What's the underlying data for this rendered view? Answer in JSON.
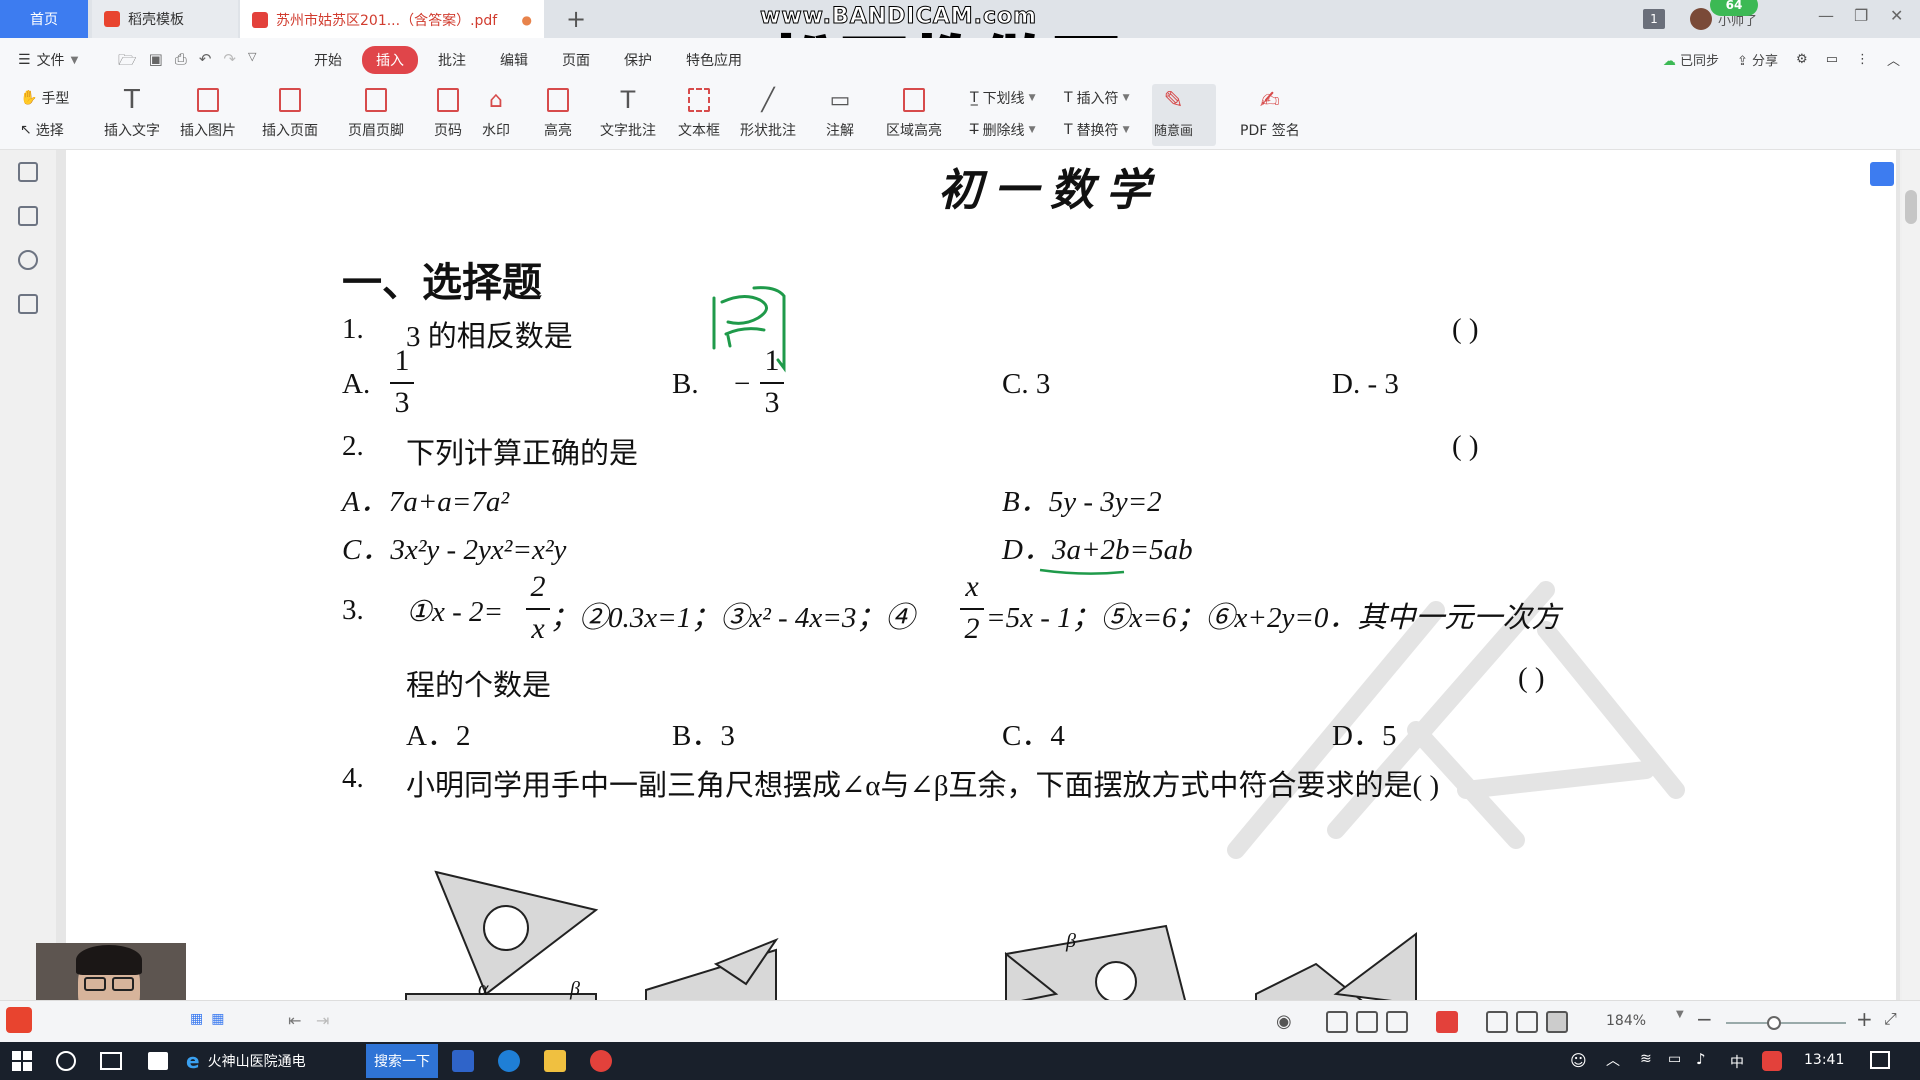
{
  "tabbar": {
    "home": "首页",
    "tab1": "稻壳模板",
    "tab2": "苏州市姑苏区201...（含答案）.pdf",
    "tab2_dot": "●",
    "add": "+",
    "page_badge": "1",
    "user_name": "小帅了",
    "badge": "64"
  },
  "menu": {
    "file": "文件",
    "tabs": [
      "开始",
      "插入",
      "批注",
      "编辑",
      "页面",
      "保护",
      "特色应用"
    ],
    "active": "插入",
    "synced": "已同步",
    "share": "分享"
  },
  "ribbon": {
    "hand": "手型",
    "select": "选择",
    "items": [
      "插入文字",
      "插入图片",
      "插入页面",
      "页眉页脚",
      "页码",
      "水印",
      "高亮",
      "文字批注",
      "文本框",
      "形状批注",
      "注解",
      "区域高亮",
      "随意画",
      "PDF 签名"
    ],
    "underline": "下划线",
    "strike": "删除线",
    "insert_mark": "插入符",
    "replace_mark": "替换符"
  },
  "overlay": {
    "bandicam": "www.BANDICAM.com",
    "title": "松哥教做题"
  },
  "doc": {
    "title": "初一数学",
    "section": "一、选择题",
    "q1": {
      "num": "1.",
      "text": "3 的相反数是",
      "paren": "(        )",
      "A": "A.",
      "B": "B.",
      "B_sign": "−",
      "C": "C.  3",
      "D": "D.  - 3",
      "frac_num": "1",
      "frac_den": "3"
    },
    "q2": {
      "num": "2.",
      "text": "下列计算正确的是",
      "paren": "(        )",
      "A": "A．7a+a=7a²",
      "B": "B．5y - 3y=2",
      "C": "C．3x²y - 2yx²=x²y",
      "D": "D．3a+2b=5ab"
    },
    "q3": {
      "num": "3.",
      "text1": "①x - 2=",
      "frac1_num": "2",
      "frac1_den": "x",
      "text2": "；②0.3x=1；③x² - 4x=3；④",
      "frac2_num": "x",
      "frac2_den": "2",
      "text3": "=5x - 1；⑤x=6；⑥x+2y=0．其中一元一次方",
      "text4": "程的个数是",
      "paren": "(        )",
      "A": "A．2",
      "B": "B．3",
      "C": "C．4",
      "D": "D．5"
    },
    "q4": {
      "num": "4.",
      "text": "小明同学用手中一副三角尺想摆成∠α与∠β互余，下面摆放方式中符合要求的是(        )"
    },
    "alpha": "α",
    "beta": "β"
  },
  "status": {
    "zoom": "184%",
    "zoom_level": 0.4
  },
  "taskbar": {
    "app": "火神山医院通电",
    "search": "搜索一下",
    "ime": "中",
    "time": "13:41"
  }
}
